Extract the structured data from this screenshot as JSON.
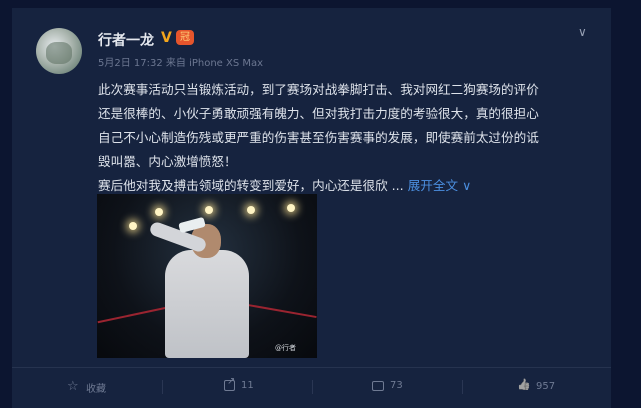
{
  "post": {
    "username": "行者一龙",
    "verified_badge": "V",
    "member_badge": "冠",
    "meta": "5月2日 17:32 来自 iPhone XS Max",
    "content": [
      "此次赛事活动只当锻炼活动，到了赛场对战拳脚打击、我对网红二狗赛场的评价",
      "还是很棒的、小伙子勇敢顽强有魄力、但对我打击力度的考验很大，真的很担心",
      "自己不小心制造伤残或更严重的伤害甚至伤害赛事的发展，即使赛前太过份的诋",
      "毁叫嚣、内心激增愤怒！",
      "赛后他对我及搏击领域的转变到爱好，内心还是很欣 ..."
    ],
    "expand_label": "展开全文",
    "expand_icon": "∨",
    "menu_icon": "∨",
    "image_watermark": "@行者"
  },
  "actions": {
    "favorite_label": "收藏",
    "share_count": "11",
    "comment_count": "73",
    "like_count": "957"
  }
}
